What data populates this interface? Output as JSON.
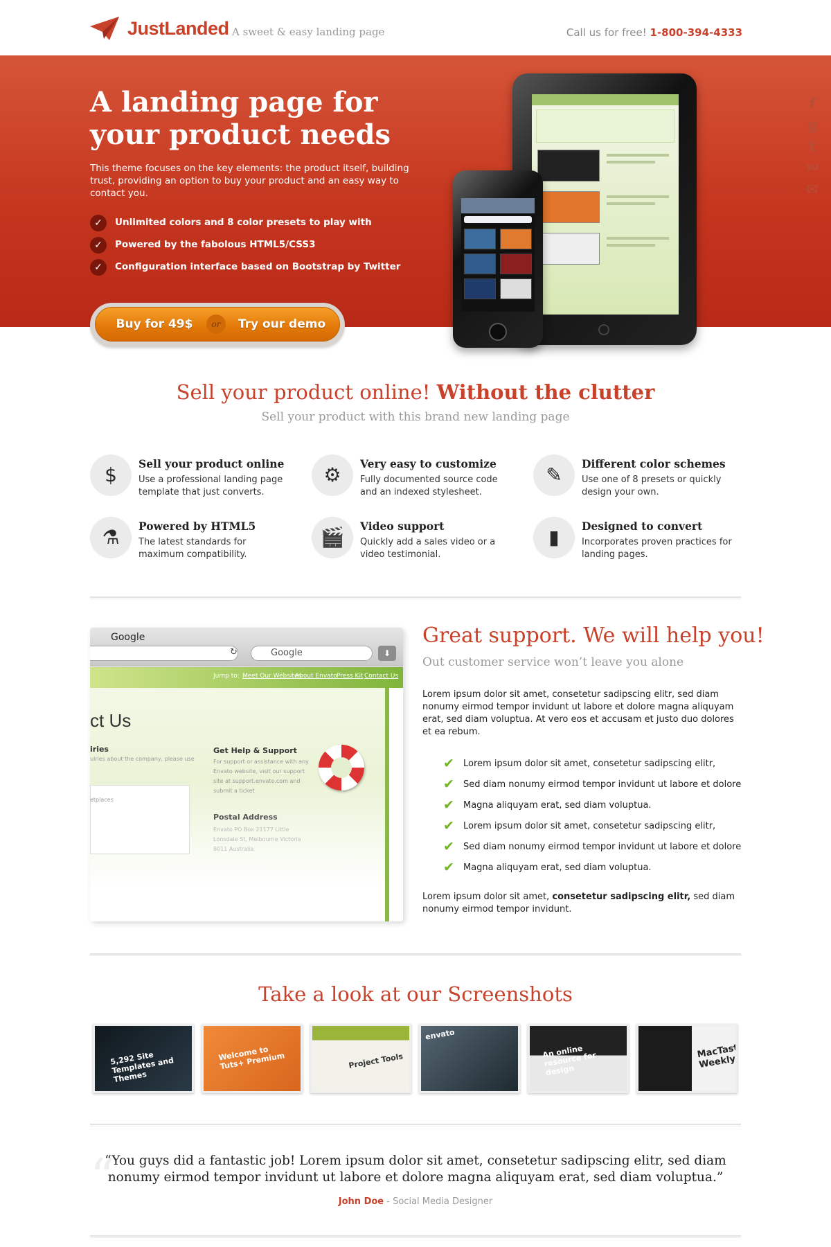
{
  "header": {
    "brand": "JustLanded",
    "tagline": "A sweet & easy landing page",
    "call_label": "Call us for free!",
    "phone": "1-800-394-4333"
  },
  "hero": {
    "title_line1": "A landing page for",
    "title_line2": "your product needs",
    "description": "This theme focuses on the key elements: the product itself, building trust, providing an option to buy your product and an easy way to contact you.",
    "features": [
      "Unlimited colors and 8 color presets to play with",
      "Powered by the fabolous HTML5/CSS3",
      "Configuration interface based on Bootstrap by Twitter"
    ],
    "buy_label": "Buy for 49$",
    "or_label": "or",
    "demo_label": "Try our demo"
  },
  "social": [
    "f",
    "g",
    "t",
    "su",
    "✉"
  ],
  "sell": {
    "title_regular": "Sell your product online!",
    "title_bold": "Without the clutter",
    "subtitle": "Sell your product with this brand new landing page",
    "items": [
      {
        "icon": "tag-dollar-icon",
        "glyph": "$",
        "title": "Sell your product online",
        "text": "Use a professional landing page template that just converts."
      },
      {
        "icon": "gear-icon",
        "glyph": "⚙",
        "title": "Very easy to customize",
        "text": "Fully documented source code and an indexed stylesheet."
      },
      {
        "icon": "paintbrush-icon",
        "glyph": "✎",
        "title": "Different color schemes",
        "text": "Use one of 8 presets or quickly design your own."
      },
      {
        "icon": "flask-icon",
        "glyph": "⚗",
        "title": "Powered by HTML5",
        "text": "The latest standards for maximum compatibility."
      },
      {
        "icon": "clapperboard-icon",
        "glyph": "🎬",
        "title": "Video support",
        "text": "Quickly add a sales video or a video testimonial."
      },
      {
        "icon": "document-icon",
        "glyph": "▮",
        "title": "Designed to convert",
        "text": "Incorporates proven practices for landing pages."
      }
    ]
  },
  "support": {
    "title": "Great support. We will help you!",
    "subtitle": "Out customer service won’t leave you alone",
    "paragraph1": "Lorem ipsum dolor sit amet, consetetur sadipscing elitr, sed diam nonumy eirmod tempor invidunt ut labore et dolore magna aliquyam erat, sed diam voluptua. At vero eos et accusam et justo duo dolores et ea rebum.",
    "list": [
      "Lorem ipsum dolor sit amet, consetetur sadipscing elitr,",
      "Sed diam nonumy eirmod tempor invidunt ut labore et dolore",
      "Magna aliquyam erat, sed diam voluptua.",
      "Lorem ipsum dolor sit amet, consetetur sadipscing elitr,",
      "Sed diam nonumy eirmod tempor invidunt ut labore et dolore",
      "Magna aliquyam erat, sed diam voluptua."
    ],
    "paragraph2_start": "Lorem ipsum dolor sit amet,",
    "paragraph2_bold": "consetetur sadipscing elitr,",
    "paragraph2_end": "sed diam nonumy eirmod tempor invidunt.",
    "browser": {
      "window_title": "Google",
      "search_placeholder": "Google",
      "nav": [
        "Jump to:",
        "Meet Our Websites",
        "About Envato",
        "Press Kit",
        "Contact Us"
      ],
      "page_heading": "ct Us",
      "enquiries": "iries",
      "enquiries_text": "uiries about the company, please use",
      "marketplaces": "etplaces",
      "help_title": "Get Help & Support",
      "help_text": "For support or assistance with any Envato website, visit our support site at support.envato.com and submit a ticket",
      "postal_title": "Postal Address",
      "postal_text": "Envato PO Box 21177 Little Lonsdale St, Melbourne Victoria 8011 Australia"
    }
  },
  "screenshots": {
    "title": "Take a look at our Screenshots",
    "items": [
      {
        "label": "5,292 Site Templates and Themes",
        "bg": "#1d2a33"
      },
      {
        "label": "Welcome to Tuts+ Premium",
        "bg": "#e2762c"
      },
      {
        "label": "Project Tools",
        "bg": "#c9d79a"
      },
      {
        "label": "envato",
        "bg": "#3a4650"
      },
      {
        "label": "An online resource for design",
        "bg": "#2b2b2b"
      },
      {
        "label": "MacTast Weekly",
        "bg": "#1b1b1b"
      }
    ]
  },
  "testimonial": {
    "quote": "“You guys did a fantastic job! Lorem ipsum dolor sit amet, consetetur sadipscing elitr, sed diam nonumy eirmod tempor invidunt ut labore et dolore magna aliquyam erat, sed diam voluptua.”",
    "author": "John Doe",
    "separator": "-",
    "role": "Social Media Designer"
  },
  "colors": {
    "accent": "#c8412b",
    "hero_bg": "#c5361f",
    "cta_orange": "#e37808",
    "check_green": "#73b324"
  }
}
